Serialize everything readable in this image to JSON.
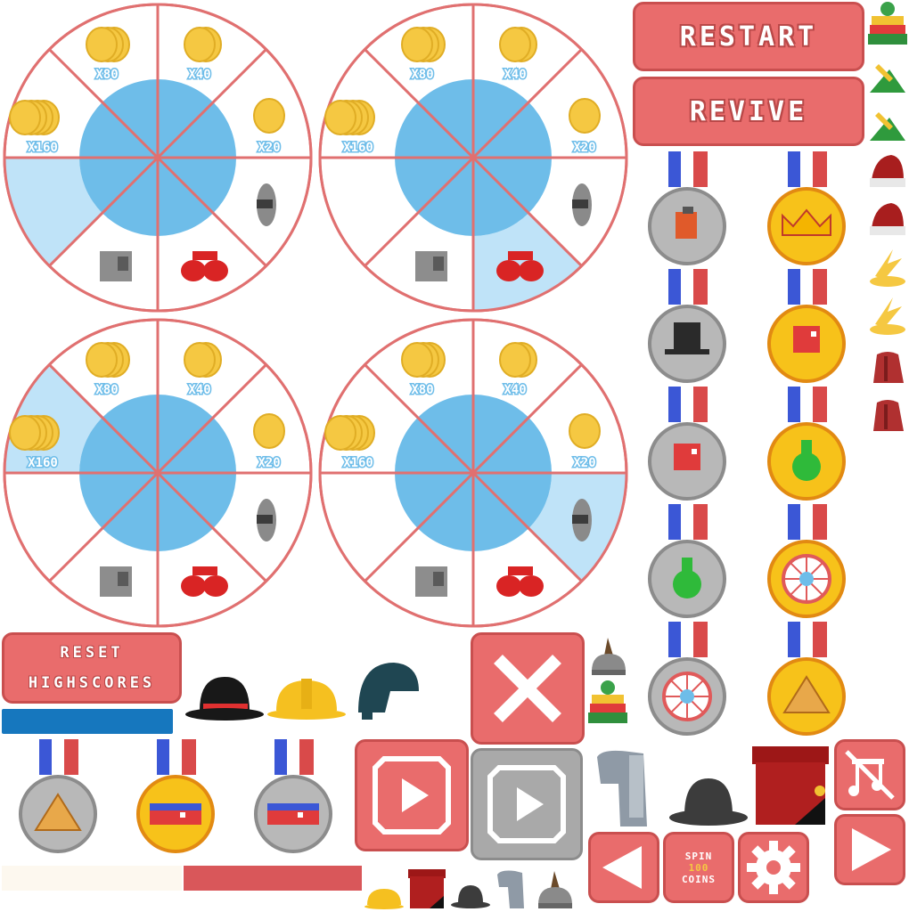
{
  "wheel": {
    "prizes": [
      "X80",
      "X40",
      "X160",
      "X20"
    ],
    "highlighted_segments": [
      5,
      3,
      6,
      2
    ]
  },
  "buttons": {
    "restart": "RESTART",
    "revive": "REVIVE",
    "reset_highscores": [
      "RESET",
      "HIGHSCORES"
    ],
    "spin": [
      "SPIN",
      "100",
      "COINS"
    ]
  },
  "colors": {
    "button": "#e96c6c",
    "button_border": "#c94f4f",
    "wheel_line": "#e07070",
    "wheel_inner": "#6ebde9",
    "wheel_highlight": "#bfe3f8",
    "coin": "#f5c842",
    "gold_medal": "#f7c21a",
    "silver_medal": "#b8b8b8",
    "progress_blue": "#1677be",
    "progress_red": "#d9575a"
  },
  "icons": {
    "hats": [
      "beanie-hat-icon",
      "robin-hood-hat-icon",
      "santa-hat-icon",
      "fire-hat-icon",
      "fez-hat-icon",
      "bowler-hat-icon",
      "hard-hat-icon",
      "helmet-icon",
      "viking-helmet-icon",
      "top-hat-icon",
      "guard-hat-icon"
    ],
    "medals": [
      "gas-can-medal-icon",
      "crown-medal-icon",
      "top-hat-medal-icon",
      "runner-medal-icon",
      "runner-silver-medal-icon",
      "potion-medal-icon",
      "potion-silver-medal-icon",
      "wheel-medal-icon",
      "wheel-silver-medal-icon",
      "pyramid-medal-icon",
      "pyramid-silver-medal-icon",
      "headband-medal-icon",
      "headband-silver-medal-icon"
    ],
    "controls": [
      "close-icon",
      "play-icon",
      "play-disabled-icon",
      "back-arrow-icon",
      "gear-icon",
      "mute-icon",
      "forward-arrow-icon"
    ]
  }
}
